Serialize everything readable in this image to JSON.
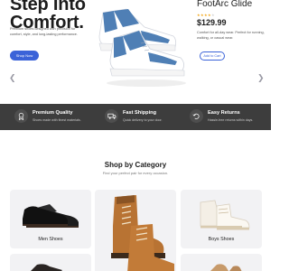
{
  "hero": {
    "title_line1": "Step Into",
    "title_line2": "Comfort.",
    "description": "Premium shoes designed with precision for comfort, style, and long-lasting performance.",
    "cta": "Shop Now"
  },
  "product": {
    "name": "FootArc Glide",
    "rating": 4,
    "rating_max": 5,
    "price": "$129.99",
    "description": "Comfort for all-day wear. Perfect for running, walking, or casual wear.",
    "cta": "Add to Cart"
  },
  "carousel": {
    "prev_icon": "chevron-left-icon",
    "next_icon": "chevron-right-icon"
  },
  "features": [
    {
      "title": "Premium Quality",
      "subtitle": "Shoes made with finest materials.",
      "icon": "medal-icon"
    },
    {
      "title": "Fast Shipping",
      "subtitle": "Quick delivery to your door.",
      "icon": "truck-icon"
    },
    {
      "title": "Easy Returns",
      "subtitle": "Hassle-free returns within days.",
      "icon": "return-icon"
    }
  ],
  "category": {
    "title": "Shop by Category",
    "subtitle": "Find your perfect pair for every occasion.",
    "items": [
      {
        "label": "Men Shoes"
      },
      {
        "label": ""
      },
      {
        "label": "Boys Shoes"
      }
    ]
  },
  "colors": {
    "accent": "#3b63d8",
    "dark": "#3d3d3d",
    "star": "#f2a516",
    "card": "#f2f2f4"
  }
}
